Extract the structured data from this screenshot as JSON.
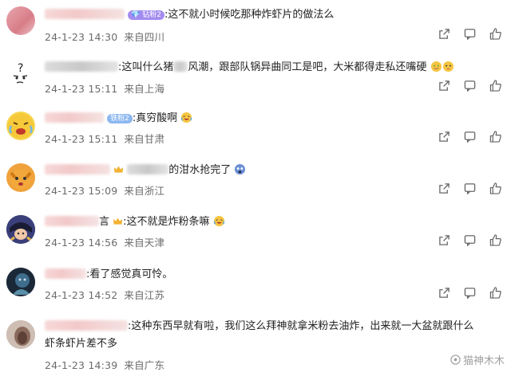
{
  "comments": [
    {
      "badge": "钻粉2",
      "text": ":这不就小时候吃那种炸虾片的做法么",
      "date": "24-1-23 14:30",
      "location": "来自四川"
    },
    {
      "text": ":这叫什么猪",
      "text2": "风潮，跟部队锅异曲同工是吧，大米都得走私还嘴硬",
      "date": "24-1-23 15:11",
      "location": "来自上海"
    },
    {
      "badge": "铁粉2",
      "text": ":真穷酸啊",
      "date": "24-1-23 15:11",
      "location": "来自甘肃"
    },
    {
      "text": "的泔水抢完了",
      "date": "24-1-23 15:09",
      "location": "来自浙江"
    },
    {
      "prefix": "言",
      "text": ":这不就是炸粉条嘛",
      "date": "24-1-23 14:56",
      "location": "来自天津"
    },
    {
      "text": ":看了感觉真可怜。",
      "date": "24-1-23 14:52",
      "location": "来自江苏"
    },
    {
      "text": ":这种东西早就有啦，我们这么拜神就拿米粉去油炸，出来就一大盆就跟什么",
      "text2": "虾条虾片差不多",
      "date": "24-1-23 14:39",
      "location": "来自广东"
    }
  ],
  "watermark": "猫神木木",
  "colors": {
    "meta": "#6b6b6b",
    "badge_purple": "#a38cf0",
    "badge_blue": "#8db8f0"
  }
}
